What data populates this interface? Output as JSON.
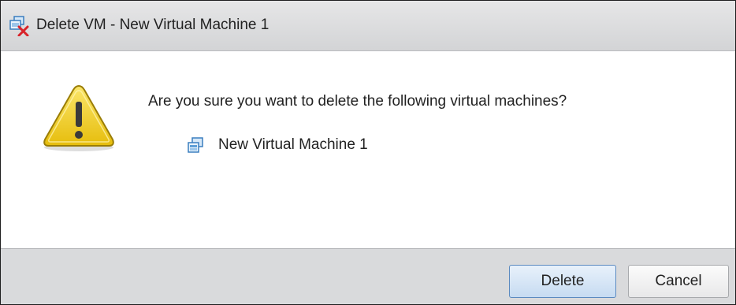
{
  "dialog": {
    "title": "Delete VM - New Virtual Machine 1",
    "title_icon": "delete-vm-icon",
    "warning_icon": "warning-icon",
    "message": "Are you sure you want to delete the following virtual machines?",
    "items": [
      {
        "label": "New Virtual Machine 1",
        "icon": "virtual-machine-icon"
      }
    ]
  },
  "buttons": {
    "delete_label": "Delete",
    "cancel_label": "Cancel"
  },
  "colors": {
    "titlebar": "#d9dadc",
    "footer": "#d9dadc",
    "delete_border": "#5b8ac0",
    "vm_icon_blue": "#3a7ebf",
    "warning_yellow": "#f3d31c",
    "close_red": "#d8232a"
  }
}
